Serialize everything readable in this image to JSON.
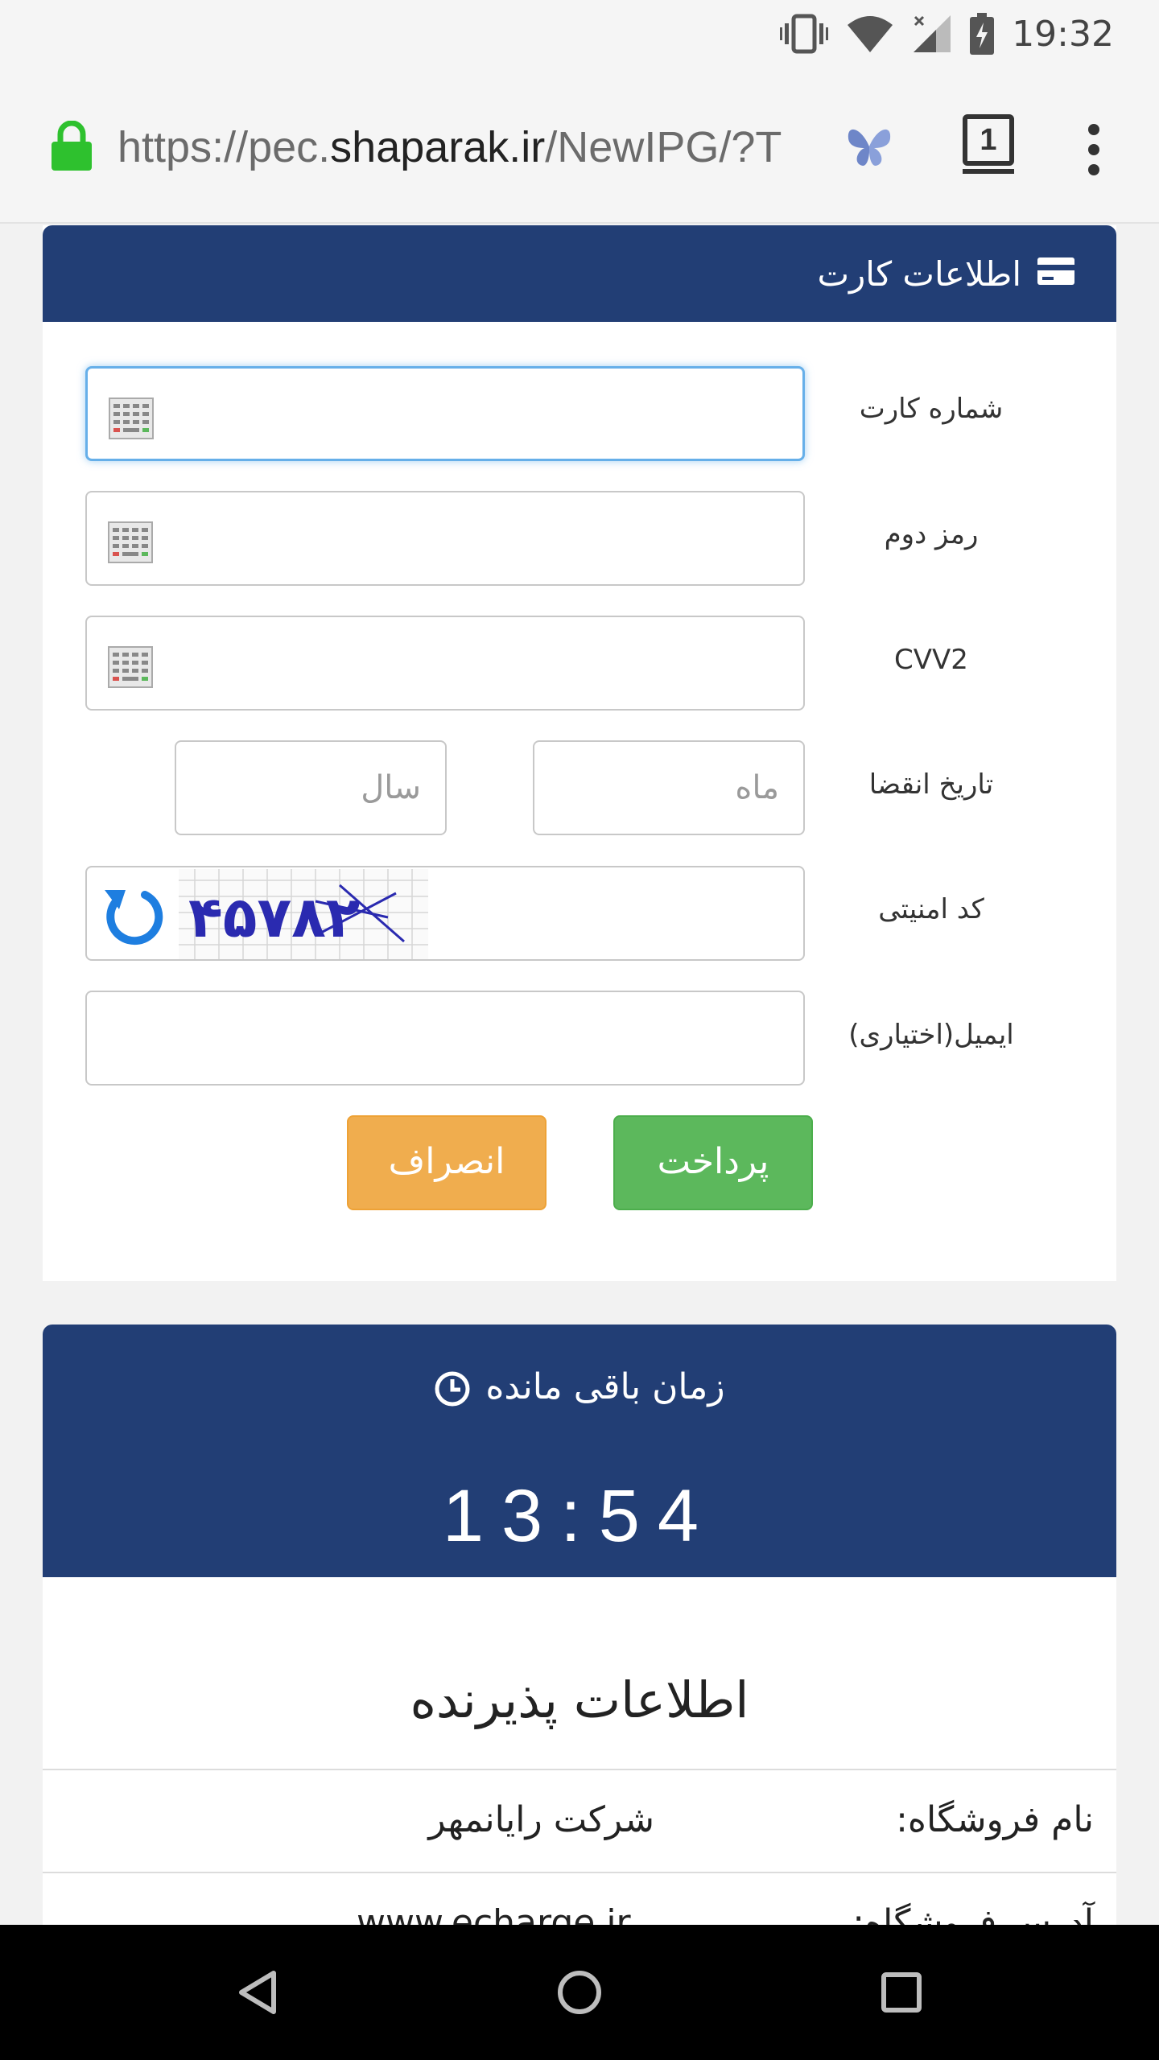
{
  "status_bar": {
    "time": "19:32"
  },
  "browser": {
    "url_prefix": "https://pec.",
    "url_host": "shaparak.ir",
    "url_suffix": "/NewIPG/?T",
    "tab_count": "1"
  },
  "card_panel": {
    "title": "اطلاعات کارت",
    "fields": {
      "card_number_label": "شماره کارت",
      "second_password_label": "رمز دوم",
      "cvv2_label": "CVV2",
      "expiry_label": "تاریخ انقضا",
      "month_placeholder": "ماه",
      "year_placeholder": "سال",
      "security_code_label": "کد امنیتی",
      "captcha_text": "۴۵۷۸۲",
      "email_label": "ایمیل(اختیاری)"
    },
    "pay_button": "پرداخت",
    "cancel_button": "انصراف"
  },
  "timer": {
    "title": "زمان باقی مانده",
    "value": "13:54"
  },
  "merchant": {
    "title": "اطلاعات پذیرنده",
    "rows": [
      {
        "label": "نام فروشگاه:",
        "value": "شرکت رایانمهر"
      },
      {
        "label": "آدرس فروشگاه:",
        "value": "www.echarge.ir"
      }
    ]
  },
  "colors": {
    "header_blue": "#223e75",
    "pay_green": "#5cb85c",
    "cancel_orange": "#f0ad4e",
    "lock_green": "#2ec12e"
  }
}
